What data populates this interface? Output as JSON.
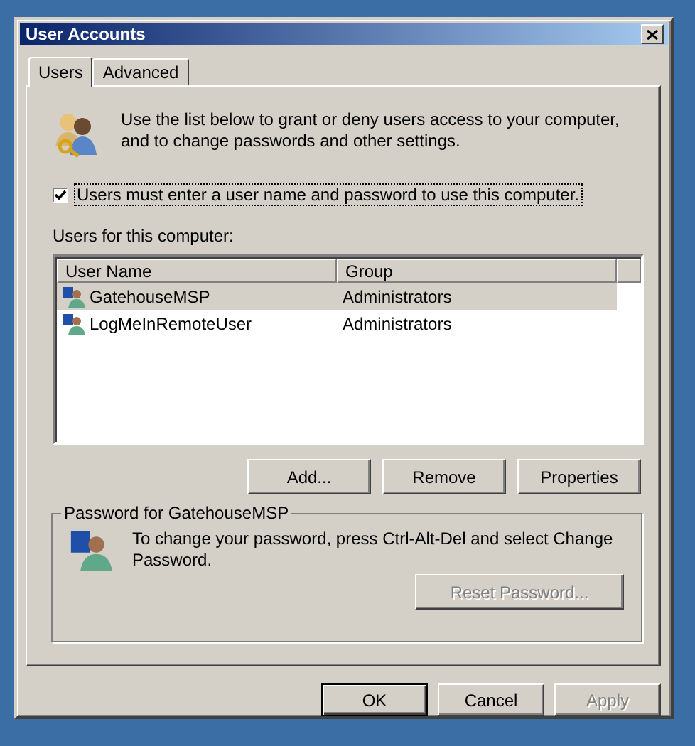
{
  "window": {
    "title": "User Accounts"
  },
  "tabs": [
    {
      "label": "Users",
      "selected": true
    },
    {
      "label": "Advanced",
      "selected": false
    }
  ],
  "intro": "Use the list below to grant or deny users access to your computer, and to change passwords and other settings.",
  "require_password": {
    "label": "Users must enter a user name and password to use this computer.",
    "checked": true
  },
  "users_label": "Users for this computer:",
  "table": {
    "columns": [
      "User Name",
      "Group"
    ],
    "rows": [
      {
        "user_name": "GatehouseMSP",
        "group": "Administrators",
        "selected": true
      },
      {
        "user_name": "LogMeInRemoteUser",
        "group": "Administrators",
        "selected": false
      }
    ]
  },
  "list_buttons": [
    {
      "label": "Add...",
      "disabled": false
    },
    {
      "label": "Remove",
      "disabled": false
    },
    {
      "label": "Properties",
      "disabled": false
    }
  ],
  "password_group": {
    "title": "Password for GatehouseMSP",
    "text": "To change your password, press Ctrl-Alt-Del and select Change Password.",
    "button": {
      "label": "Reset Password...",
      "disabled": true
    }
  },
  "dialog_buttons": [
    {
      "label": "OK",
      "disabled": false,
      "default": true
    },
    {
      "label": "Cancel",
      "disabled": false,
      "default": false
    },
    {
      "label": "Apply",
      "disabled": true,
      "default": false
    }
  ]
}
